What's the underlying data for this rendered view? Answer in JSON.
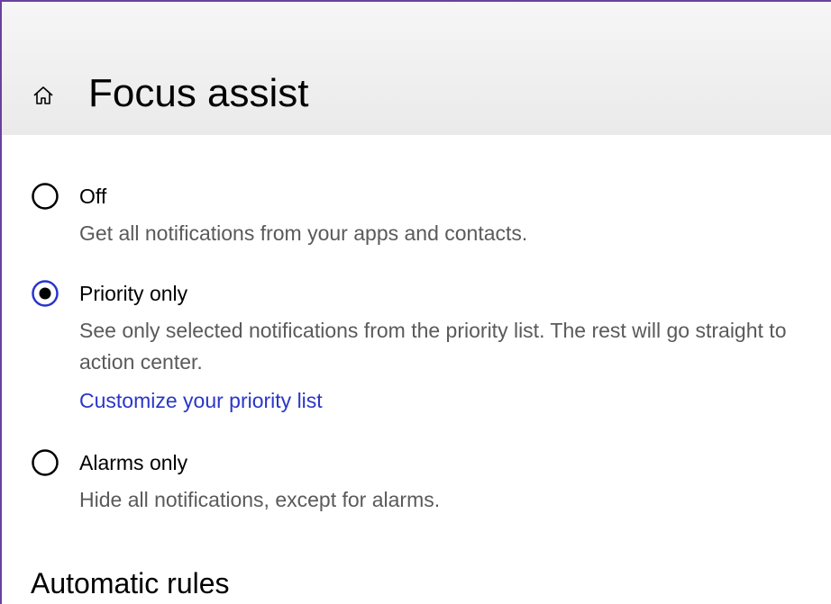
{
  "header": {
    "title": "Focus assist",
    "home_icon": "home-icon"
  },
  "options": [
    {
      "label": "Off",
      "description": "Get all notifications from your apps and contacts.",
      "selected": false
    },
    {
      "label": "Priority only",
      "description": "See only selected notifications from the priority list. The rest will go straight to action center.",
      "link": "Customize your priority list",
      "selected": true
    },
    {
      "label": "Alarms only",
      "description": "Hide all notifications, except for alarms.",
      "selected": false
    }
  ],
  "sections": {
    "automatic_rules": "Automatic rules"
  },
  "colors": {
    "accent": "#2a36c8",
    "radio_selected_ring": "#2a36c8",
    "description_text": "#5a5a5a",
    "window_border": "#6b3fa0"
  }
}
